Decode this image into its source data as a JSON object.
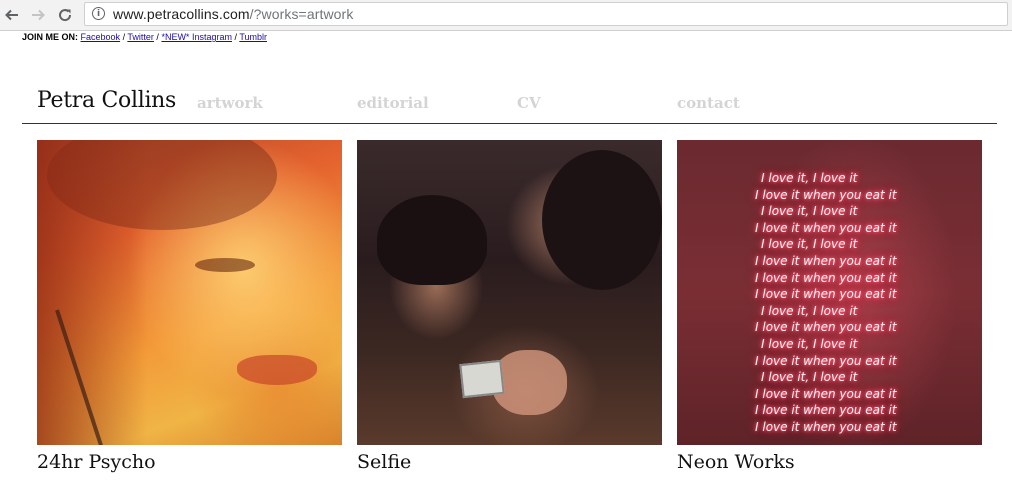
{
  "browser": {
    "url_host": "www.petracollins.com",
    "url_path": "/?works=artwork"
  },
  "social": {
    "label": "JOIN ME ON:",
    "links": [
      "Facebook",
      "Twitter",
      "*NEW* Instagram",
      "Tumblr"
    ],
    "separator": " / "
  },
  "header": {
    "site_title": "Petra Collins",
    "nav": [
      "artwork",
      "editorial",
      "CV",
      "contact"
    ]
  },
  "works": [
    {
      "caption": "24hr Psycho"
    },
    {
      "caption": "Selfie"
    },
    {
      "caption": "Neon Works"
    }
  ],
  "neon_lines": [
    "I love it, I love it",
    "I love it when  you eat it",
    "I love it, I love it",
    "I love it when  you eat it",
    "I love it, I love it",
    "I love it when  you eat it",
    "I love it when  you eat it",
    "I love it when  you eat it",
    "I love it, I love it",
    "I love it when you eat it",
    "I love it, I love it",
    "I love it when you eat it",
    "I love it, I love it",
    "I love it when  you eat it",
    "I love it when  you eat it",
    "I love it when  you eat it"
  ],
  "colors": {
    "nav_inactive": "#d4d4d4",
    "link": "#1a0dab"
  }
}
